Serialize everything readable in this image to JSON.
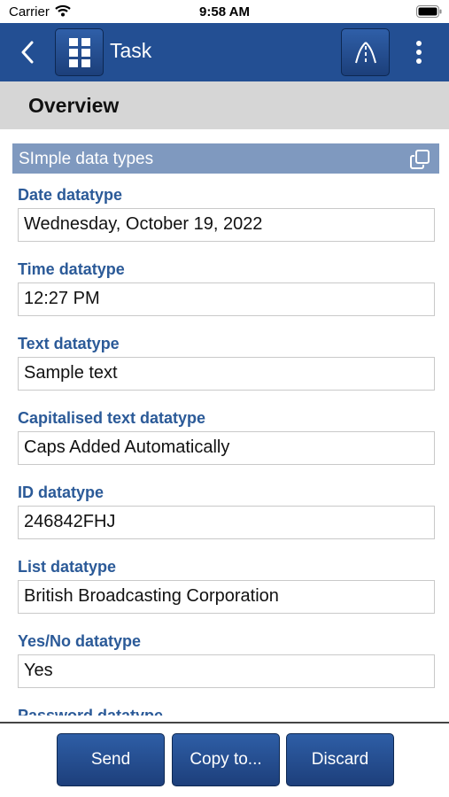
{
  "status": {
    "carrier": "Carrier",
    "time": "9:58 AM"
  },
  "nav": {
    "title": "Task"
  },
  "section": {
    "title": "Overview"
  },
  "group": {
    "title": "SImple data types"
  },
  "fields": [
    {
      "label": "Date datatype",
      "value": "Wednesday, October 19, 2022"
    },
    {
      "label": "Time datatype",
      "value": "12:27 PM"
    },
    {
      "label": "Text datatype",
      "value": "Sample text"
    },
    {
      "label": "Capitalised text datatype",
      "value": "Caps Added Automatically"
    },
    {
      "label": "ID datatype",
      "value": "246842FHJ"
    },
    {
      "label": "List datatype",
      "value": "British Broadcasting Corporation"
    },
    {
      "label": "Yes/No datatype",
      "value": "Yes"
    },
    {
      "label": "Password datatype",
      "value": ""
    }
  ],
  "toolbar": {
    "send_label": "Send",
    "copy_label": "Copy to...",
    "discard_label": "Discard"
  },
  "colors": {
    "navbar": "#234f93",
    "group_header": "#7f99bf",
    "label": "#2b5a98",
    "section_bg": "#d6d6d6"
  }
}
